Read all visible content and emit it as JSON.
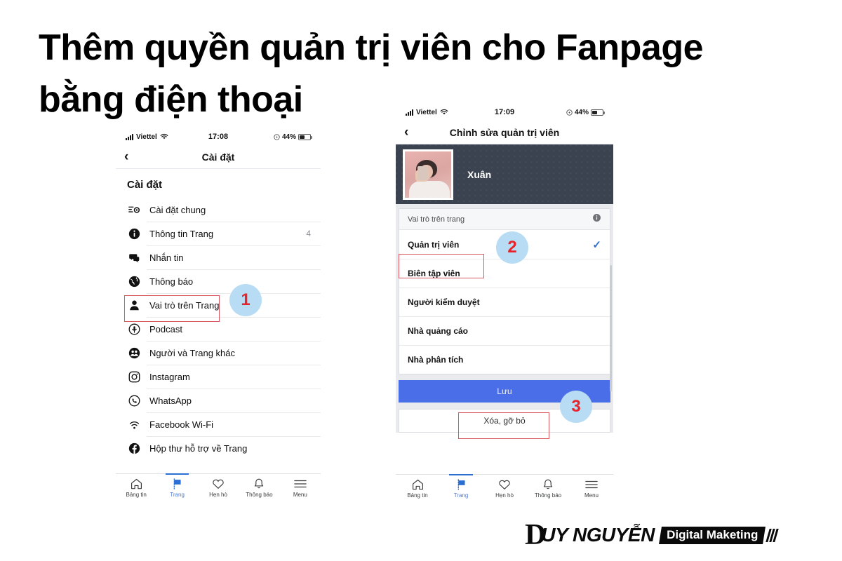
{
  "title": {
    "line1": "Thêm quyền quản trị viên cho Fanpage",
    "line2": "bằng điện thoại"
  },
  "left_phone": {
    "status_bar": {
      "carrier": "Viettel",
      "time": "17:08",
      "battery": "44%",
      "wifi_icon": "wifi-icon",
      "signal_icon": "signal-bars-icon",
      "battery_icon": "battery-icon",
      "charging_icon": "charging-icon"
    },
    "nav": {
      "back_icon": "chevron-left-icon",
      "title": "Cài đặt"
    },
    "section_title": "Cài đặt",
    "items": [
      {
        "label": "Cài đặt chung",
        "icon": "sliders-gear-icon",
        "count": ""
      },
      {
        "label": "Thông tin Trang",
        "icon": "info-circle-icon",
        "count": "4"
      },
      {
        "label": "Nhắn tin",
        "icon": "chat-bubbles-icon",
        "count": ""
      },
      {
        "label": "Thông báo",
        "icon": "globe-icon",
        "count": ""
      },
      {
        "label": "Vai trò trên Trang",
        "icon": "person-icon",
        "count": ""
      },
      {
        "label": "Podcast",
        "icon": "podcast-icon",
        "count": ""
      },
      {
        "label": "Người và Trang khác",
        "icon": "people-group-icon",
        "count": ""
      },
      {
        "label": "Instagram",
        "icon": "instagram-icon",
        "count": ""
      },
      {
        "label": "WhatsApp",
        "icon": "whatsapp-icon",
        "count": ""
      },
      {
        "label": "Facebook Wi-Fi",
        "icon": "wifi-icon",
        "count": ""
      },
      {
        "label": "Hộp thư hỗ trợ về Trang",
        "icon": "facebook-icon",
        "count": ""
      }
    ],
    "tabs": [
      {
        "label": "Bảng tin",
        "icon": "home-icon",
        "active": false
      },
      {
        "label": "Trang",
        "icon": "flag-icon",
        "active": true
      },
      {
        "label": "Hẹn hò",
        "icon": "heart-icon",
        "active": false
      },
      {
        "label": "Thông báo",
        "icon": "bell-icon",
        "active": false
      },
      {
        "label": "Menu",
        "icon": "hamburger-menu-icon",
        "active": false
      }
    ]
  },
  "right_phone": {
    "status_bar": {
      "carrier": "Viettel",
      "time": "17:09",
      "battery": "44%",
      "wifi_icon": "wifi-icon",
      "signal_icon": "signal-bars-icon",
      "battery_icon": "battery-icon",
      "charging_icon": "charging-icon"
    },
    "nav": {
      "back_icon": "chevron-left-icon",
      "title": "Chỉnh sửa quản trị viên"
    },
    "cover": {
      "name": "Xuân",
      "photo_icon": "profile-photo"
    },
    "role_section": {
      "header_label": "Vai trò trên trang",
      "info_icon": "info-circle-icon",
      "roles": [
        {
          "label": "Quản trị viên",
          "selected": true
        },
        {
          "label": "Biên tập viên",
          "selected": false
        },
        {
          "label": "Người kiểm duyệt",
          "selected": false
        },
        {
          "label": "Nhà quảng cáo",
          "selected": false
        },
        {
          "label": "Nhà phân tích",
          "selected": false
        }
      ],
      "check_icon": "checkmark-icon"
    },
    "save_label": "Lưu",
    "remove_label": "Xóa, gỡ bỏ",
    "tabs": [
      {
        "label": "Bảng tin",
        "icon": "home-icon",
        "active": false
      },
      {
        "label": "Trang",
        "icon": "flag-icon",
        "active": true
      },
      {
        "label": "Hẹn hò",
        "icon": "heart-icon",
        "active": false
      },
      {
        "label": "Thông báo",
        "icon": "bell-icon",
        "active": false
      },
      {
        "label": "Menu",
        "icon": "hamburger-menu-icon",
        "active": false
      }
    ]
  },
  "annotations": [
    {
      "number": "1"
    },
    {
      "number": "2"
    },
    {
      "number": "3"
    }
  ],
  "logo": {
    "monogram": "D",
    "name": "UY NGUYỄN",
    "tagline": "Digital Maketing"
  },
  "colors": {
    "badge_bg": "#b7dcf3",
    "badge_text": "#e8232a",
    "highlight_box": "#d9555f",
    "save_button": "#4a6ee8",
    "tab_active": "#4a7ad4",
    "cover_bg": "#3c4350"
  }
}
